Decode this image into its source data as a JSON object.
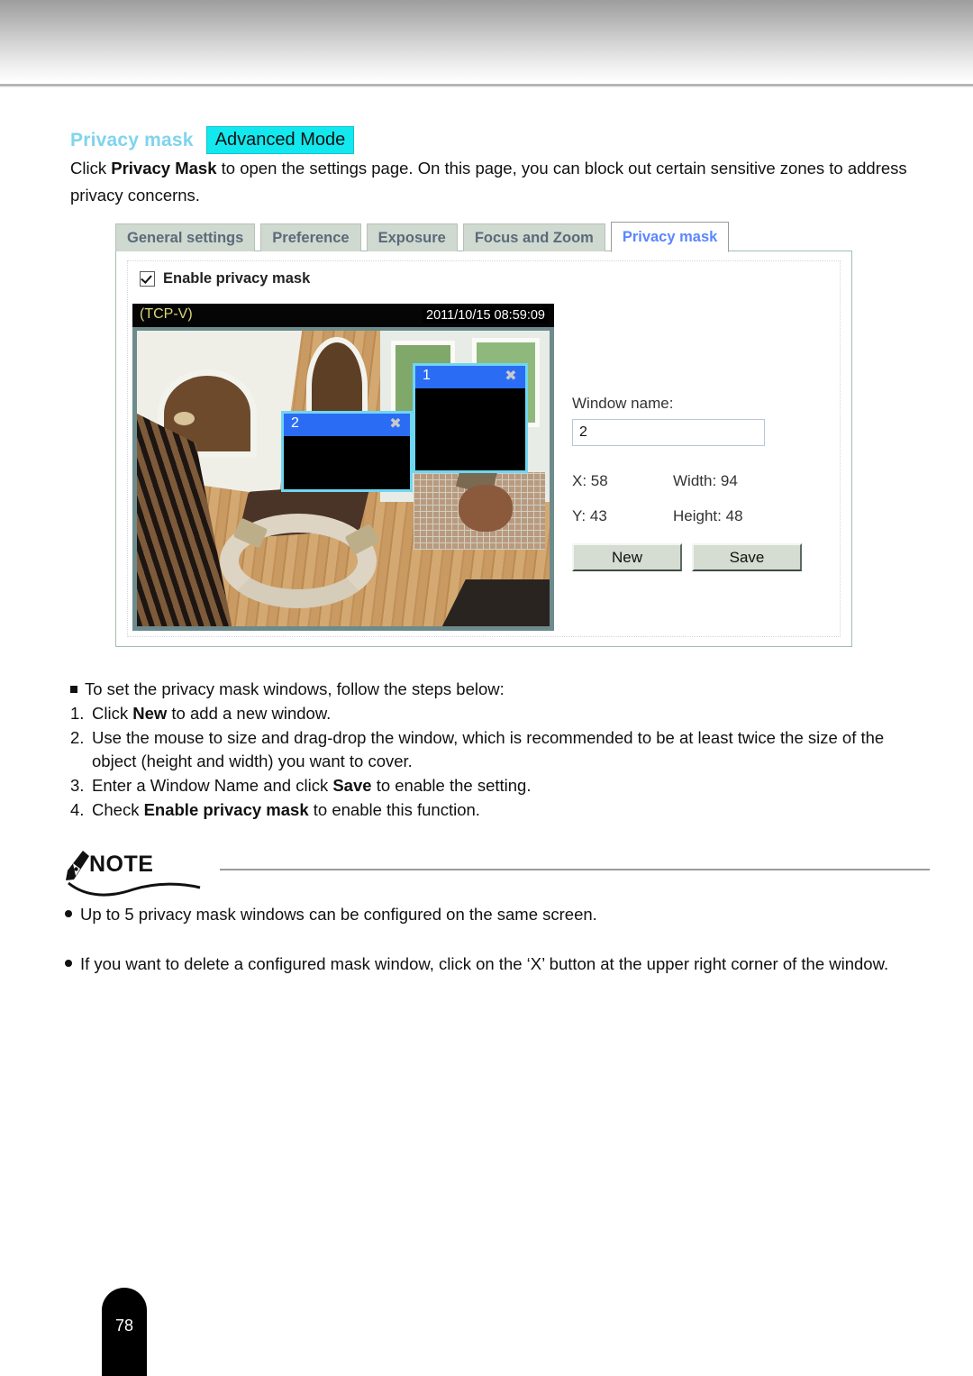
{
  "section": {
    "title": "Privacy mask",
    "mode_badge": "Advanced Mode",
    "intro_prefix": "Click ",
    "intro_bold": "Privacy Mask",
    "intro_rest": " to open the settings page. On this page, you can block out certain sensitive zones to address privacy concerns."
  },
  "ui": {
    "tabs": [
      {
        "label": "General settings",
        "active": false
      },
      {
        "label": "Preference",
        "active": false
      },
      {
        "label": "Exposure",
        "active": false
      },
      {
        "label": "Focus and Zoom",
        "active": false
      },
      {
        "label": "Privacy mask",
        "active": true
      }
    ],
    "enable_checkbox": {
      "label": "Enable privacy mask",
      "checked": true
    },
    "video": {
      "channel": "(TCP-V)",
      "timestamp": "2011/10/15  08:59:09"
    },
    "mask_windows": [
      {
        "number": "1",
        "close": "✖"
      },
      {
        "number": "2",
        "close": "✖"
      }
    ],
    "controls": {
      "window_name_label": "Window name:",
      "window_name_value": "2",
      "x_label": "X:",
      "x_value": "58",
      "y_label": "Y:",
      "y_value": "43",
      "width_label": "Width:",
      "width_value": "94",
      "height_label": "Height:",
      "height_value": "48",
      "new_button": "New",
      "save_button": "Save"
    },
    "colors": {
      "tab_bg": "#cfd9cf",
      "tab_text": "#5a6a7a",
      "active_tab_text": "#5a86ff",
      "mask_titlebar": "#2b6cf5",
      "mask_border": "#6fd6f2",
      "badge_bg": "#12e8ee",
      "section_title": "#7fd4ec"
    }
  },
  "steps": {
    "intro": "To set the privacy mask windows, follow the steps below:",
    "items": [
      {
        "n": "1.",
        "pre": "Click ",
        "bold": "New",
        "post": " to add a new window."
      },
      {
        "n": "2.",
        "pre": "Use the mouse to size and drag-drop the window, which is recommended to be at least twice the size of the object (height and width) you want to cover.",
        "bold": "",
        "post": ""
      },
      {
        "n": "3.",
        "pre": "Enter a Window Name and click ",
        "bold": "Save",
        "post": " to enable the setting."
      },
      {
        "n": "4.",
        "pre": "Check ",
        "bold": "Enable privacy mask",
        "post": " to enable this function."
      }
    ]
  },
  "note": {
    "heading": "NOTE",
    "items": [
      "Up to 5 privacy mask windows can be configured on the same screen.",
      "If you want to delete a configured mask window, click on the ‘X’ button at the upper right corner of the window."
    ]
  },
  "footer": {
    "page_number": "78"
  }
}
